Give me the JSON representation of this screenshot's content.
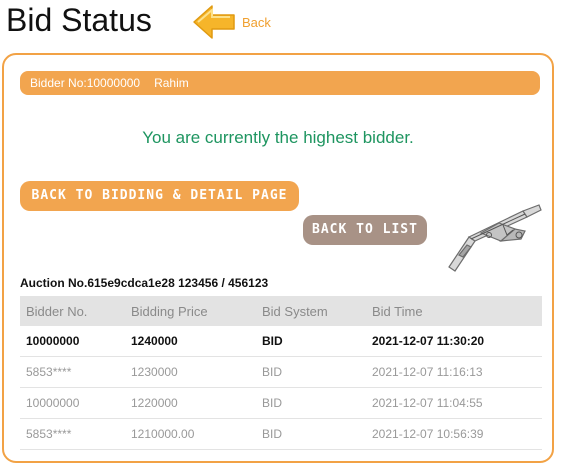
{
  "page": {
    "title": "Bid Status",
    "back_label": "Back"
  },
  "bidder": {
    "label": "Bidder No:10000000",
    "name": "Rahim"
  },
  "status_message": "You are currently the highest bidder.",
  "buttons": {
    "detail_label": "BACK TO BIDDING & DETAIL PAGE",
    "list_label": "BACK TO LIST"
  },
  "auction": {
    "line": "Auction No.615e9cdca1e28  123456 / 456123"
  },
  "table": {
    "headers": [
      "Bidder No.",
      "Bidding Price",
      "Bid System",
      "Bid Time"
    ],
    "rows": [
      [
        "10000000",
        "1240000",
        "BID",
        "2021-12-07 11:30:20"
      ],
      [
        "5853****",
        "1230000",
        "BID",
        "2021-12-07 11:16:13"
      ],
      [
        "10000000",
        "1220000",
        "BID",
        "2021-12-07 11:04:55"
      ],
      [
        "5853****",
        "1210000.00",
        "BID",
        "2021-12-07 10:56:39"
      ]
    ]
  },
  "colors": {
    "accent": "#f2a54f",
    "success": "#1e9560",
    "secondary_button": "#a89286"
  },
  "icons": {
    "back": "back-arrow-icon"
  }
}
